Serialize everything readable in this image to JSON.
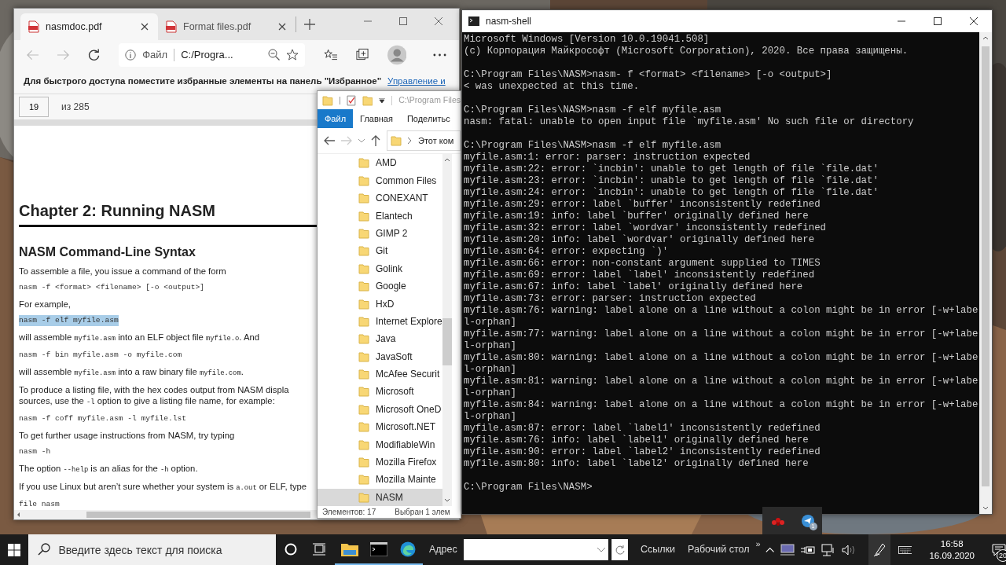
{
  "browser": {
    "tabs": [
      {
        "title": "nasmdoc.pdf",
        "selected": true
      },
      {
        "title": "Format files.pdf",
        "selected": false
      }
    ],
    "address": {
      "scheme": "Файл",
      "url": "C:/Progra..."
    },
    "favorites_bar": {
      "message": "Для быстрого доступа поместите избранные элементы на панель \"Избранное\"",
      "link": "Управление и"
    },
    "pdf_toolbar": {
      "page": "19",
      "total": "из 285"
    },
    "document": [
      {
        "kind": "heading1",
        "text": "Chapter 2: Running NASM"
      },
      {
        "kind": "heading2",
        "text": "NASM Command-Line Syntax"
      },
      {
        "kind": "para",
        "lines": [
          [
            {
              "text": "To assemble a file, you issue a command of the form",
              "kind": "text"
            }
          ]
        ]
      },
      {
        "kind": "code",
        "text": "nasm -f <format> <filename> [-o <output>]",
        "highlighted": false
      },
      {
        "kind": "para",
        "lines": [
          [
            {
              "text": "For example,",
              "kind": "text"
            }
          ]
        ]
      },
      {
        "kind": "code",
        "text": "nasm -f elf myfile.asm",
        "highlighted": true
      },
      {
        "kind": "para",
        "lines": [
          [
            {
              "text": "will assemble ",
              "kind": "text"
            },
            {
              "text": "myfile.asm",
              "kind": "code"
            },
            {
              "text": " into an ELF object file ",
              "kind": "text"
            },
            {
              "text": "myfile.o",
              "kind": "code"
            },
            {
              "text": ". And",
              "kind": "text"
            }
          ]
        ]
      },
      {
        "kind": "code",
        "text": "nasm -f bin myfile.asm -o myfile.com",
        "highlighted": false
      },
      {
        "kind": "para",
        "lines": [
          [
            {
              "text": "will assemble ",
              "kind": "text"
            },
            {
              "text": "myfile.asm",
              "kind": "code"
            },
            {
              "text": " into a raw binary file ",
              "kind": "text"
            },
            {
              "text": "myfile.com",
              "kind": "code"
            },
            {
              "text": ".",
              "kind": "text"
            }
          ]
        ]
      },
      {
        "kind": "para",
        "lines": [
          [
            {
              "text": "To produce a listing file, with the hex codes output from NASM displa",
              "kind": "text"
            }
          ],
          [
            {
              "text": "sources, use the ",
              "kind": "text"
            },
            {
              "text": "-l",
              "kind": "code"
            },
            {
              "text": " option to give a listing file name, for example:",
              "kind": "text"
            }
          ]
        ]
      },
      {
        "kind": "code",
        "text": "nasm -f coff myfile.asm -l myfile.lst",
        "highlighted": false
      },
      {
        "kind": "para",
        "lines": [
          [
            {
              "text": "To get further usage instructions from NASM, try typing",
              "kind": "text"
            }
          ]
        ]
      },
      {
        "kind": "code",
        "text": "nasm -h",
        "highlighted": false
      },
      {
        "kind": "para",
        "lines": [
          [
            {
              "text": "The option ",
              "kind": "text"
            },
            {
              "text": "--help",
              "kind": "code"
            },
            {
              "text": " is an alias for the ",
              "kind": "text"
            },
            {
              "text": "-h",
              "kind": "code"
            },
            {
              "text": " option.",
              "kind": "text"
            }
          ]
        ]
      },
      {
        "kind": "para",
        "lines": [
          [
            {
              "text": "If you use Linux but aren’t sure whether your system is ",
              "kind": "text"
            },
            {
              "text": "a.out",
              "kind": "code"
            },
            {
              "text": " or ELF, type",
              "kind": "text"
            }
          ]
        ]
      },
      {
        "kind": "code",
        "text": "file nasm",
        "highlighted": false
      }
    ]
  },
  "explorer": {
    "path": "C:\\Program Files",
    "ribbon_tabs": [
      {
        "label": "Файл",
        "selected": true
      },
      {
        "label": "Главная",
        "selected": false
      },
      {
        "label": "Поделитьс",
        "selected": false
      }
    ],
    "address": "Этот ком",
    "items": [
      {
        "name": "AMD",
        "selected": false
      },
      {
        "name": "Common Files",
        "selected": false
      },
      {
        "name": "CONEXANT",
        "selected": false
      },
      {
        "name": "Elantech",
        "selected": false
      },
      {
        "name": "GIMP 2",
        "selected": false
      },
      {
        "name": "Git",
        "selected": false
      },
      {
        "name": "Golink",
        "selected": false
      },
      {
        "name": "Google",
        "selected": false
      },
      {
        "name": "HxD",
        "selected": false
      },
      {
        "name": "Internet Explore",
        "selected": false
      },
      {
        "name": "Java",
        "selected": false
      },
      {
        "name": "JavaSoft",
        "selected": false
      },
      {
        "name": "McAfee Securit",
        "selected": false
      },
      {
        "name": "Microsoft",
        "selected": false
      },
      {
        "name": "Microsoft OneD",
        "selected": false
      },
      {
        "name": "Microsoft.NET",
        "selected": false
      },
      {
        "name": "ModifiableWin",
        "selected": false
      },
      {
        "name": "Mozilla Firefox",
        "selected": false
      },
      {
        "name": "Mozilla Mainte",
        "selected": false
      },
      {
        "name": "NASM",
        "selected": true
      }
    ],
    "status": {
      "count": "Элементов: 17",
      "selection": "Выбран 1 элем"
    }
  },
  "terminal": {
    "title": "nasm-shell",
    "blocks": [
      {
        "lines": [
          "Microsoft Windows [Version 10.0.19041.508]",
          "(c) Корпорация Майкрософт (Microsoft Corporation), 2020. Все права защищены."
        ]
      },
      {
        "lines": [
          "C:\\Program Files\\NASM>nasm- f <format> <filename> [-o <output>]",
          "< was unexpected at this time."
        ]
      },
      {
        "lines": [
          "C:\\Program Files\\NASM>nasm -f elf myfile.asm",
          "nasm: fatal: unable to open input file `myfile.asm' No such file or directory"
        ]
      },
      {
        "lines": [
          "C:\\Program Files\\NASM>nasm -f elf myfile.asm",
          "myfile.asm:1: error: parser: instruction expected",
          "myfile.asm:22: error: `incbin': unable to get length of file `file.dat'",
          "myfile.asm:23: error: `incbin': unable to get length of file `file.dat'",
          "myfile.asm:24: error: `incbin': unable to get length of file `file.dat'",
          "myfile.asm:29: error: label `buffer' inconsistently redefined",
          "myfile.asm:19: info: label `buffer' originally defined here",
          "myfile.asm:32: error: label `wordvar' inconsistently redefined",
          "myfile.asm:20: info: label `wordvar' originally defined here",
          "myfile.asm:64: error: expecting `)'",
          "myfile.asm:66: error: non-constant argument supplied to TIMES",
          "myfile.asm:69: error: label `label' inconsistently redefined",
          "myfile.asm:67: info: label `label' originally defined here",
          "myfile.asm:73: error: parser: instruction expected",
          "myfile.asm:76: warning: label alone on a line without a colon might be in error [-w+labe",
          "l-orphan]",
          "myfile.asm:77: warning: label alone on a line without a colon might be in error [-w+labe",
          "l-orphan]",
          "myfile.asm:80: warning: label alone on a line without a colon might be in error [-w+labe",
          "l-orphan]",
          "myfile.asm:81: warning: label alone on a line without a colon might be in error [-w+labe",
          "l-orphan]",
          "myfile.asm:84: warning: label alone on a line without a colon might be in error [-w+labe",
          "l-orphan]",
          "myfile.asm:87: error: label `label1' inconsistently redefined",
          "myfile.asm:76: info: label `label1' originally defined here",
          "myfile.asm:90: error: label `label2' inconsistently redefined",
          "myfile.asm:80: info: label `label2' originally defined here"
        ]
      },
      {
        "lines": [
          "C:\\Program Files\\NASM>"
        ]
      }
    ]
  },
  "tray_popup": {
    "icons": [
      {
        "kind": "berries"
      },
      {
        "kind": "messenger",
        "badge": "1"
      }
    ]
  },
  "taskbar": {
    "search_placeholder": "Введите здесь текст для поиска",
    "apps": [
      {
        "kind": "explorer",
        "running": true
      },
      {
        "kind": "console",
        "running": true
      },
      {
        "kind": "edge",
        "running": true
      }
    ],
    "address_label": "Адрес",
    "toolbars": [
      "Ссылки",
      "Рабочий стол"
    ],
    "overflow_glyph": "»",
    "clock": {
      "time": "16:58",
      "date": "16.09.2020"
    },
    "notifications": "20"
  }
}
